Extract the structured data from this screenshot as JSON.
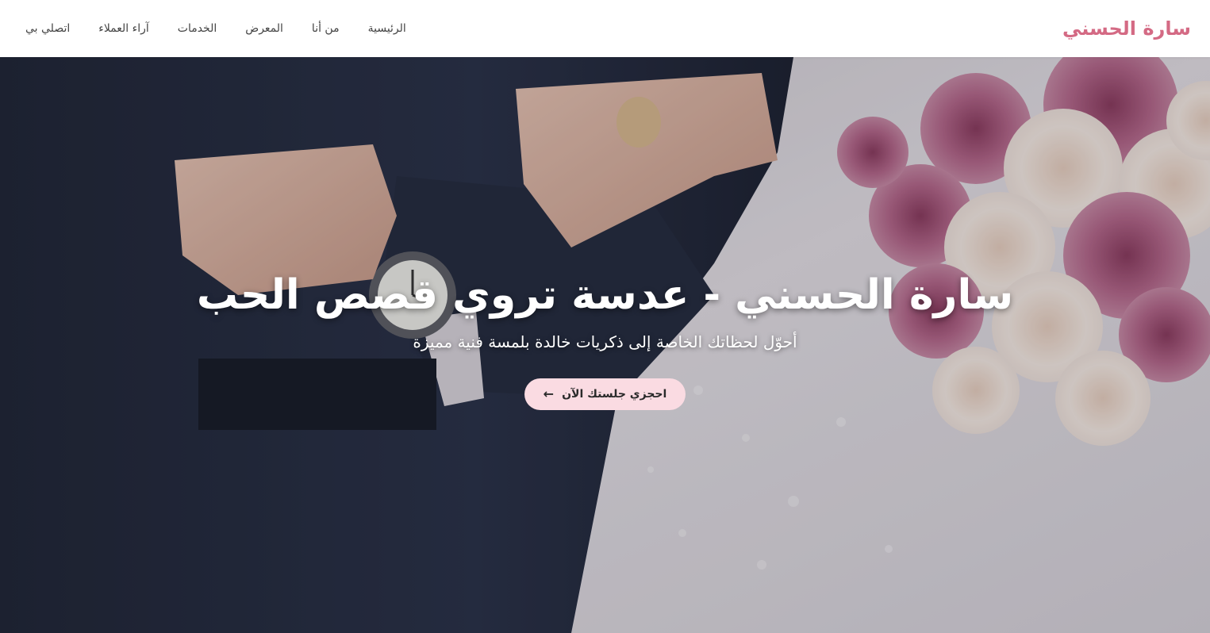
{
  "header": {
    "brand": "سارة الحسني",
    "nav": [
      "الرئيسية",
      "من أنا",
      "المعرض",
      "الخدمات",
      "آراء العملاء",
      "اتصلي بي"
    ]
  },
  "hero": {
    "title": "سارة الحسني - عدسة تروي قصص الحب",
    "subtitle": "أحوّل لحظاتك الخاصة إلى ذكريات خالدة بلمسة فنية مميزة",
    "cta_label": "احجزي جلستك الآن",
    "cta_icon": "arrow-left-icon"
  },
  "colors": {
    "brand": "#d46a84",
    "cta_bg": "#fadbe2",
    "nav_text": "#444444"
  }
}
